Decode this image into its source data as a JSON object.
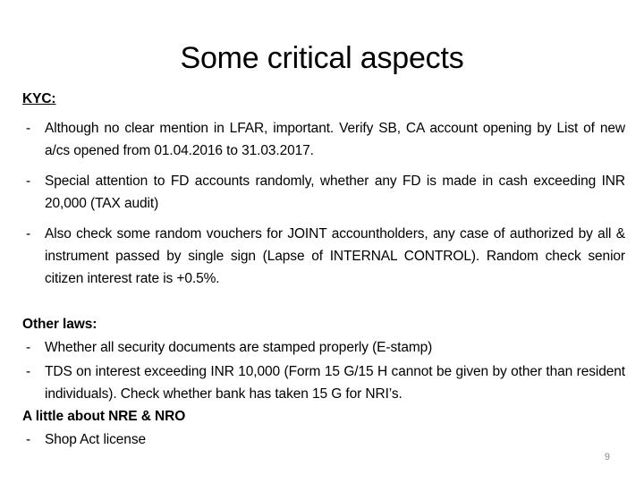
{
  "slide": {
    "title": "Some critical aspects",
    "page_number": "9",
    "background_color": "#ffffff",
    "text_color": "#000000",
    "page_number_color": "#8a8a8a"
  },
  "sections": {
    "kyc": {
      "heading": "KYC:",
      "bullet_marker": "-",
      "items": [
        "Although no clear mention in LFAR, important. Verify SB, CA account opening by List of new a/cs opened from 01.04.2016 to 31.03.2017.",
        "Special attention to FD accounts randomly, whether any FD is made in cash exceeding INR 20,000 (TAX audit)",
        "Also check some random vouchers for JOINT accountholders, any case of authorized by all & instrument passed by single sign (Lapse of INTERNAL CONTROL). Random check senior citizen interest rate is +0.5%."
      ]
    },
    "other_laws": {
      "heading": "Other laws:",
      "bullet_marker": "-",
      "items": [
        "Whether all security documents are stamped properly (E-stamp)",
        "TDS on interest exceeding INR 10,000 (Form 15 G/15 H cannot be given by other than resident individuals). Check whether bank has taken 15 G for NRI’s."
      ]
    },
    "nre_nro": {
      "heading": "A little about NRE & NRO",
      "bullet_marker": "-",
      "items": [
        "Shop Act license"
      ]
    }
  }
}
